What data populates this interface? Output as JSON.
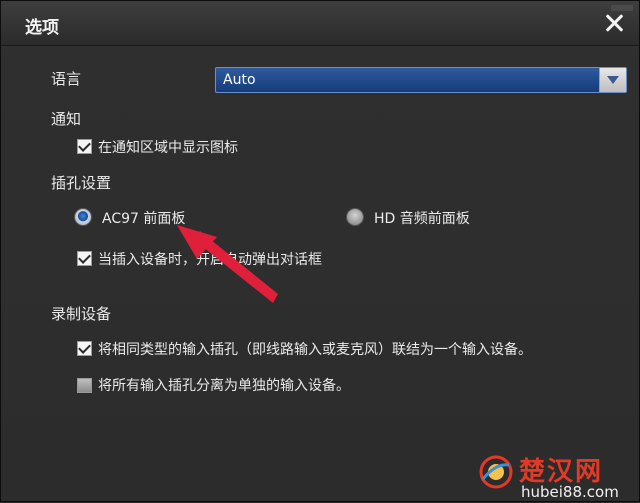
{
  "dialog": {
    "title": "选项"
  },
  "language": {
    "label": "语言",
    "value": "Auto"
  },
  "notification": {
    "section": "通知",
    "show_icon_label": "在通知区域中显示图标",
    "show_icon_checked": true
  },
  "jack": {
    "section": "插孔设置",
    "option_ac97": "AC97 前面板",
    "option_hd": "HD 音频前面板",
    "selected": "AC97 前面板",
    "popup_label": "当插入设备时，开启自动弹出对话框",
    "popup_checked": true
  },
  "recording": {
    "section": "录制设备",
    "combine_label": "将相同类型的输入插孔（即线路输入或麦克风）联结为一个输入设备。",
    "combine_checked": true,
    "separate_label": "将所有输入插孔分离为单独的输入设备。",
    "separate_checked": false
  },
  "watermark": {
    "brand": "楚汉网",
    "url": "hubei88.com"
  },
  "colors": {
    "accent": "#1a4f9c",
    "arrow": "#e0203a",
    "watermark": "#e23a26"
  }
}
